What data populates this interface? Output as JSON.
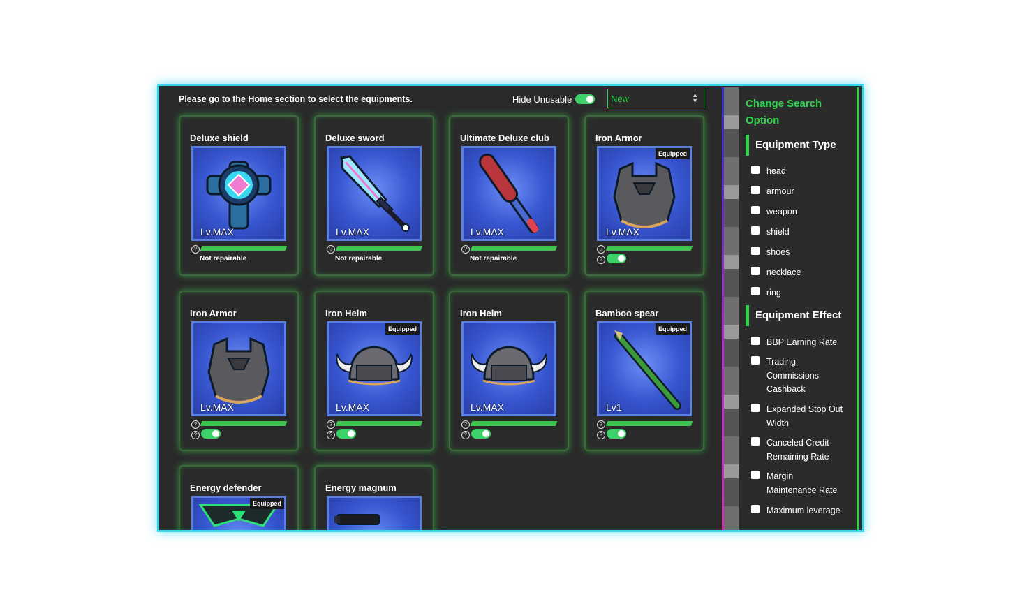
{
  "topbar": {
    "notice": "Please go to the Home section to select the equipments.",
    "hide_unusable_label": "Hide Unusable",
    "sort_select": {
      "selected": "New"
    }
  },
  "cards": [
    {
      "title": "Deluxe shield",
      "level": "Lv.MAX",
      "status": "Not repairable",
      "equipped": false,
      "icon": "shield-icon"
    },
    {
      "title": "Deluxe sword",
      "level": "Lv.MAX",
      "status": "Not repairable",
      "equipped": false,
      "icon": "sword-icon"
    },
    {
      "title": "Ultimate Deluxe club",
      "level": "Lv.MAX",
      "status": "Not repairable",
      "equipped": false,
      "icon": "club-icon"
    },
    {
      "title": "Iron Armor",
      "level": "Lv.MAX",
      "status": "",
      "equipped": true,
      "equipped_label": "Equipped",
      "icon": "armor-icon"
    },
    {
      "title": "Iron Armor",
      "level": "Lv.MAX",
      "status": "",
      "equipped": false,
      "icon": "armor-icon"
    },
    {
      "title": "Iron Helm",
      "level": "Lv.MAX",
      "status": "",
      "equipped": true,
      "equipped_label": "Equipped",
      "icon": "helm-icon"
    },
    {
      "title": "Iron Helm",
      "level": "Lv.MAX",
      "status": "",
      "equipped": false,
      "icon": "helm-icon"
    },
    {
      "title": "Bamboo spear",
      "level": "Lv1",
      "status": "",
      "equipped": true,
      "equipped_label": "Equipped",
      "icon": "spear-icon"
    },
    {
      "title": "Energy defender",
      "level": "",
      "status": "",
      "equipped": true,
      "equipped_label": "Equipped",
      "icon": "energy-defender-icon"
    },
    {
      "title": "Energy magnum",
      "level": "",
      "status": "",
      "equipped": false,
      "icon": "gun-icon"
    }
  ],
  "sidebar": {
    "title": "Change Search Option",
    "equipment_type": {
      "heading": "Equipment Type",
      "options": [
        "head",
        "armour",
        "weapon",
        "shield",
        "shoes",
        "necklace",
        "ring"
      ]
    },
    "equipment_effect": {
      "heading": "Equipment Effect",
      "options": [
        "BBP Earning Rate",
        "Trading Commissions Cashback",
        "Expanded Stop Out Width",
        "Canceled Credit Remaining Rate",
        "Margin Maintenance Rate",
        "Maximum leverage"
      ]
    }
  },
  "colors": {
    "accent_green": "#2fd24a",
    "frame_cyan": "#36d6ee",
    "thumb_blue": "#3655cf"
  }
}
